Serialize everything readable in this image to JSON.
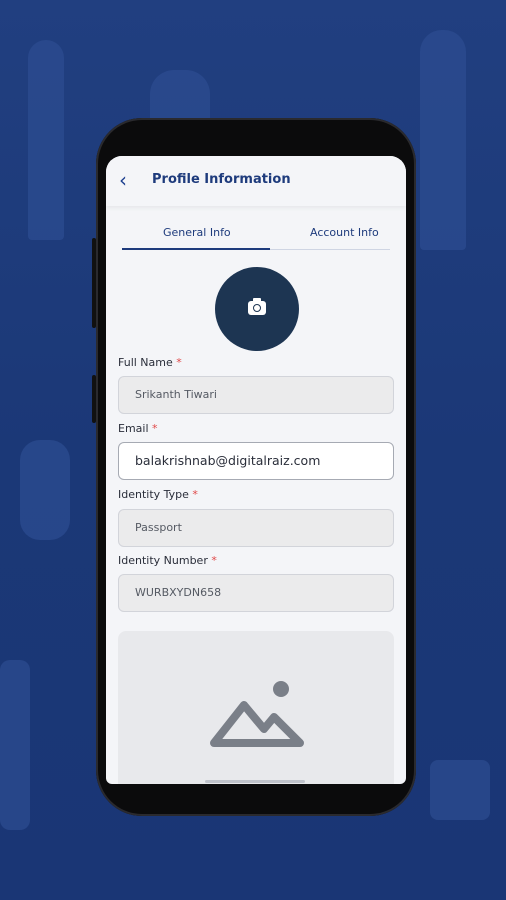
{
  "header": {
    "title": "Profile Information"
  },
  "tabs": [
    {
      "label": "General Info"
    },
    {
      "label": "Account Info"
    }
  ],
  "form": {
    "full_name": {
      "label": "Full Name",
      "required": "*",
      "value": "Srikanth Tiwari"
    },
    "email": {
      "label": "Email",
      "required": "*",
      "value": "balakrishnab@digitalraiz.com"
    },
    "identity_type": {
      "label": "Identity Type",
      "required": "*",
      "value": "Passport"
    },
    "identity_number": {
      "label": "Identity Number",
      "required": "*",
      "value": "WURBXYDN658"
    }
  },
  "icons": {
    "back": "back-arrow-icon",
    "camera": "camera-icon",
    "image_placeholder": "image-placeholder-icon"
  },
  "colors": {
    "background": "#1c3a7a",
    "accent": "#1e3b7c",
    "avatar": "#1d3552",
    "required": "#e04848"
  }
}
